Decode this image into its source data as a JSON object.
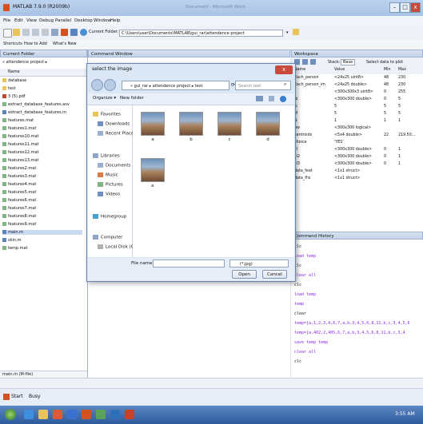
{
  "window": {
    "title": "MATLAB 7.9.0 (R2009b)",
    "faded_title": "Document - Microsoft Word",
    "minimize": "–",
    "maximize": "□",
    "close": "x"
  },
  "menu": [
    "File",
    "Edit",
    "View",
    "Debug",
    "Parallel",
    "Desktop",
    "Window",
    "Help"
  ],
  "toolbar": {
    "current_folder_label": "Current Folder:",
    "current_folder_value": "C:\\Users\\user\\Documents\\MATLAB\\gui_rar\\attendence project"
  },
  "shortcuts": {
    "label": "Shortcuts",
    "how_to_add": "How to Add",
    "whats_new": "What's New"
  },
  "current_folder": {
    "title": "Current Folder",
    "path": "« attendence project ▸",
    "column_name": "Name",
    "files": [
      "database",
      "test",
      "3 (5).pdf",
      "extract_database_features.asv",
      "extract_database_features.m",
      "features.mat",
      "features1.mat",
      "features10.mat",
      "features11.mat",
      "features12.mat",
      "features13.mat",
      "features2.mat",
      "features3.mat",
      "features4.mat",
      "features5.mat",
      "features6.mat",
      "features7.mat",
      "features8.mat",
      "features9.mat",
      "main.m",
      "skin.m",
      "temp.mat"
    ],
    "footer": "main.m (M-file)"
  },
  "command_window": {
    "title": "Command Window"
  },
  "workspace": {
    "title": "Workspace",
    "stack_label": "Stack:",
    "stack_value": "Base",
    "select_plot": "Select data to plot",
    "columns": [
      "Name",
      "Value",
      "Min",
      "Max"
    ],
    "rows": [
      [
        "Each_person",
        "<24x25 uint8>",
        "48",
        "230"
      ],
      [
        "Each_person_im",
        "<24x25 double>",
        "48",
        "230"
      ],
      [
        "I",
        "<300x300x3 uint8>",
        "0",
        "255"
      ],
      [
        "Ib",
        "<300x300 double>",
        "0",
        "5"
      ],
      [
        "Ic",
        "5",
        "5",
        "5"
      ],
      [
        "M",
        "5",
        "5",
        "5"
      ],
      [
        "N",
        "1",
        "1",
        "1"
      ],
      [
        "bw",
        "<300x300 logical>",
        "",
        ""
      ],
      [
        "centroids",
        "<5x4 double>",
        "22",
        "219.50..."
      ],
      [
        "choice",
        "'YES'",
        "",
        ""
      ],
      [
        "cl",
        "<300x300 double>",
        "0",
        "1"
      ],
      [
        "cl2",
        "<300x300 double>",
        "0",
        "1"
      ],
      [
        "cl3",
        "<300x300 double>",
        "0",
        "1"
      ],
      [
        "data_feat",
        "<1x1 struct>",
        "",
        ""
      ],
      [
        "data_fhs",
        "<1x1 struct>",
        "",
        ""
      ]
    ]
  },
  "command_history": {
    "title": "Command History",
    "lines": [
      "clc",
      "load temp",
      "clc",
      "clear all",
      "clc",
      "load temp",
      "temp",
      "clear",
      "temp=[a,1,2,3,4,6,7,a,b,3,4,5,6,8,11,b,c,3,4,5,6",
      "temp=[a,402,2,405,6,7,a,b,3,4,5,6,8,11,b,c,3,4",
      "save temp temp",
      "clear all",
      "clc"
    ]
  },
  "dialog": {
    "title": "select the image",
    "close": "x",
    "address": "« gui_rar ▸ attendence project ▸ test",
    "search_placeholder": "Search test",
    "organize": "Organize ▾",
    "new_folder": "New folder",
    "nav": [
      "Favorites",
      "Downloads",
      "Recent Places",
      "Libraries",
      "Documents",
      "Music",
      "Pictures",
      "Videos",
      "Homegroup",
      "Computer",
      "Local Disk (C:)"
    ],
    "thumbnails": [
      "a",
      "b",
      "c",
      "d",
      "e"
    ],
    "file_name_label": "File name:",
    "file_type": "(*.jpg)",
    "open": "Open",
    "cancel": "Cancel"
  },
  "startbar": {
    "start": "Start",
    "status": "Busy"
  },
  "taskbar": {
    "clock": "3:55 AM"
  },
  "colors": {
    "matlab_logo": "#d2531f",
    "dialog_close": "#c94a3a",
    "taskbar": "#2d5a9b",
    "history_purple": "#8a2be2"
  }
}
